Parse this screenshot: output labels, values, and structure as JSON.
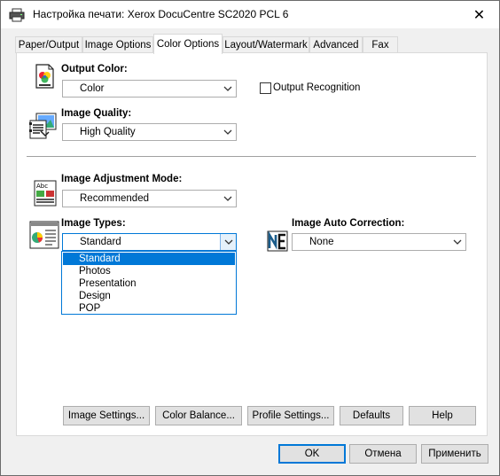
{
  "window": {
    "title": "Настройка печати: Xerox DocuCentre SC2020 PCL 6",
    "close_glyph": "✕"
  },
  "tabs": [
    {
      "label": "Paper/Output",
      "active": false
    },
    {
      "label": "Image Options",
      "active": false
    },
    {
      "label": "Color Options",
      "active": true
    },
    {
      "label": "Layout/Watermark",
      "active": false
    },
    {
      "label": "Advanced",
      "active": false
    },
    {
      "label": "Fax",
      "active": false
    }
  ],
  "output_color": {
    "label": "Output Color:",
    "value": "Color",
    "icon": "color-page-icon"
  },
  "output_recognition": {
    "label": "Output Recognition",
    "checked": false
  },
  "image_quality": {
    "label": "Image Quality:",
    "value": "High Quality",
    "icon": "image-quality-icon"
  },
  "image_adjustment_mode": {
    "label": "Image Adjustment Mode:",
    "value": "Recommended",
    "icon": "adjustment-mode-icon"
  },
  "image_types": {
    "label": "Image Types:",
    "value": "Standard",
    "icon": "image-types-icon",
    "options": [
      "Standard",
      "Photos",
      "Presentation",
      "Design",
      "POP"
    ],
    "selected_index": 0
  },
  "image_auto_correction": {
    "label": "Image Auto Correction:",
    "value": "None",
    "icon": "auto-correction-icon"
  },
  "panel_buttons": {
    "image_settings": "Image Settings...",
    "color_balance": "Color Balance...",
    "profile_settings": "Profile Settings...",
    "defaults": "Defaults",
    "help": "Help"
  },
  "dialog_buttons": {
    "ok": "OK",
    "cancel": "Отмена",
    "apply": "Применить"
  },
  "colors": {
    "accent": "#0078d7",
    "button_face": "#e1e1e1",
    "window_bg": "#f0f0f0"
  }
}
